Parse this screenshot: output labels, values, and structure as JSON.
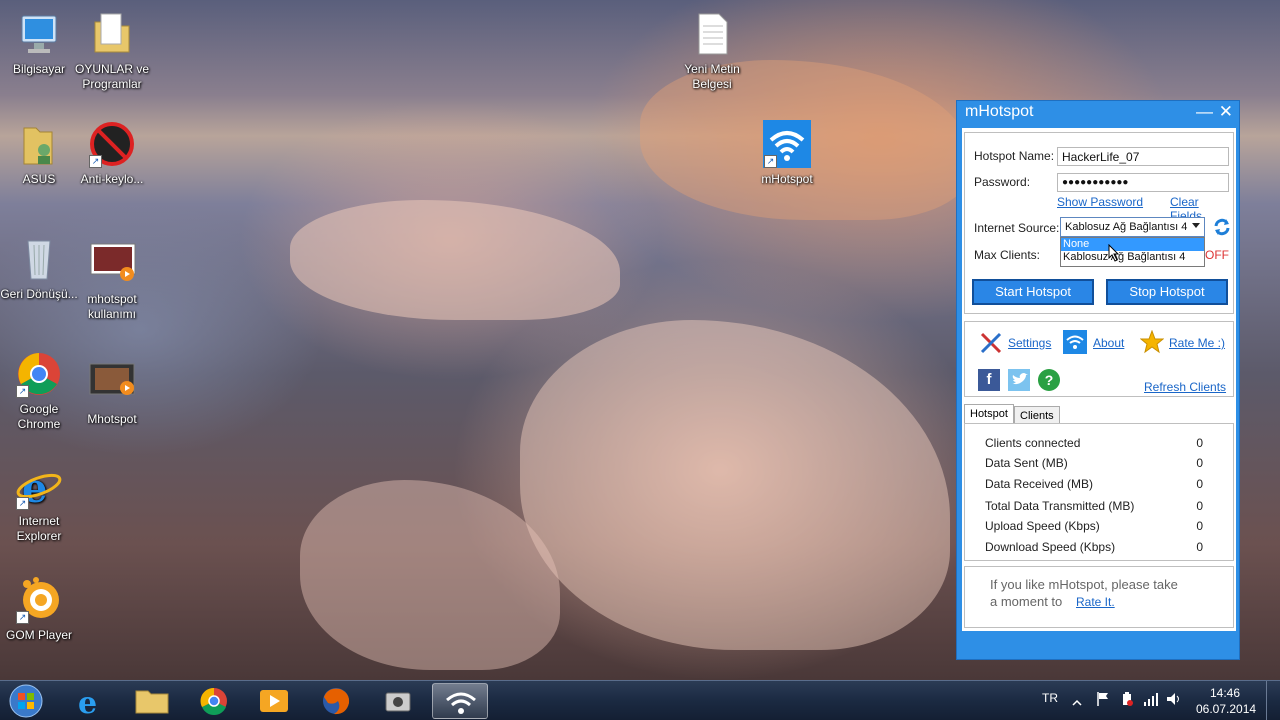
{
  "desktop": {
    "icons": [
      {
        "label": "Bilgisayar",
        "icon": "computer-icon"
      },
      {
        "label": "OYUNLAR ve Programlar",
        "icon": "folder-icon"
      },
      {
        "label": "Yeni Metin Belgesi",
        "icon": "text-document-icon"
      },
      {
        "label": "ASUS",
        "icon": "user-folder-icon"
      },
      {
        "label": "Anti-keylo...",
        "icon": "anti-keylogger-icon"
      },
      {
        "label": "mHotspot",
        "icon": "wifi-icon"
      },
      {
        "label": "Geri Dönüşü...",
        "icon": "recycle-bin-icon"
      },
      {
        "label": "mhotspot kullanımı",
        "icon": "video-file-icon"
      },
      {
        "label": "Google Chrome",
        "icon": "chrome-icon"
      },
      {
        "label": "Mhotspot",
        "icon": "video-file-icon"
      },
      {
        "label": "Internet Explorer",
        "icon": "internet-explorer-icon"
      },
      {
        "label": "GOM Player",
        "icon": "gom-player-icon"
      }
    ]
  },
  "window": {
    "title": "mHotspot",
    "minimize_glyph": "—",
    "close_glyph": "✕",
    "form": {
      "hotspot_name_label": "Hotspot Name:",
      "hotspot_name_value": "HackerLife_07",
      "password_label": "Password:",
      "password_value": "●●●●●●●●●●●",
      "show_password": "Show Password",
      "clear_fields": "Clear Fields",
      "internet_source_label": "Internet Source:",
      "internet_source_value": "Kablosuz Ağ Bağlantısı 4",
      "dropdown_options": [
        "None",
        "Kablosuz Ağ Bağlantısı 4"
      ],
      "max_clients_label": "Max Clients:",
      "off_label": "OFF",
      "start_button": "Start Hotspot",
      "stop_button": "Stop Hotspot"
    },
    "links": {
      "settings": "Settings",
      "about": "About",
      "rate_me": "Rate Me :)",
      "refresh_clients": "Refresh Clients"
    },
    "tabs": [
      "Hotspot",
      "Clients"
    ],
    "stats": [
      {
        "label": "Clients connected",
        "value": "0"
      },
      {
        "label": "Data Sent (MB)",
        "value": "0"
      },
      {
        "label": "Data Received (MB)",
        "value": "0"
      },
      {
        "label": "Total Data Transmitted (MB)",
        "value": "0"
      },
      {
        "label": "Upload Speed (Kbps)",
        "value": "0"
      },
      {
        "label": "Download Speed (Kbps)",
        "value": "0"
      }
    ],
    "promo": {
      "line1": "If you like mHotspot, please take",
      "line2": "a moment to",
      "link": "Rate It."
    }
  },
  "taskbar": {
    "language": "TR",
    "time": "14:46",
    "date": "06.07.2014",
    "accent": "#2e8fe6"
  }
}
